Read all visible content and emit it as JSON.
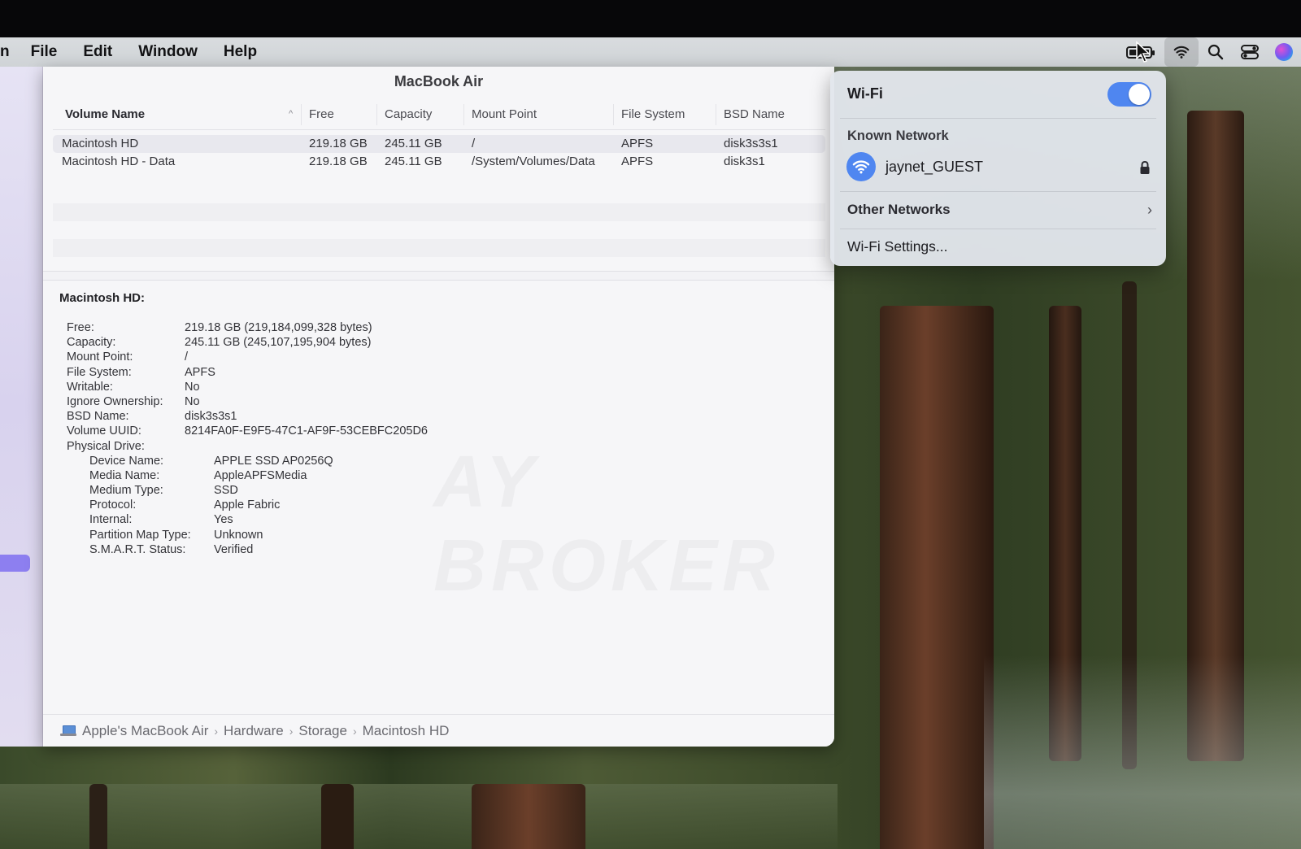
{
  "menubar": {
    "app_fragment": "n",
    "items": [
      "File",
      "Edit",
      "Window",
      "Help"
    ]
  },
  "window": {
    "title": "MacBook Air",
    "table": {
      "headers": [
        "Volume Name",
        "Free",
        "Capacity",
        "Mount Point",
        "File System",
        "BSD Name"
      ],
      "rows": [
        [
          "Macintosh HD",
          "219.18 GB",
          "245.11 GB",
          "/",
          "APFS",
          "disk3s3s1"
        ],
        [
          "Macintosh HD - Data",
          "219.18 GB",
          "245.11 GB",
          "/System/Volumes/Data",
          "APFS",
          "disk3s1"
        ]
      ]
    },
    "detail": {
      "title": "Macintosh HD:",
      "fields": [
        {
          "key": "Free:",
          "value": "219.18 GB (219,184,099,328 bytes)"
        },
        {
          "key": "Capacity:",
          "value": "245.11 GB (245,107,195,904 bytes)"
        },
        {
          "key": "Mount Point:",
          "value": "/"
        },
        {
          "key": "File System:",
          "value": "APFS"
        },
        {
          "key": "Writable:",
          "value": "No"
        },
        {
          "key": "Ignore Ownership:",
          "value": "No"
        },
        {
          "key": "BSD Name:",
          "value": "disk3s3s1"
        },
        {
          "key": "Volume UUID:",
          "value": "8214FA0F-E9F5-47C1-AF9F-53CEBFC205D6"
        },
        {
          "key": "Physical Drive:",
          "value": ""
        }
      ],
      "physical_drive": [
        {
          "key": "Device Name:",
          "value": "APPLE SSD AP0256Q"
        },
        {
          "key": "Media Name:",
          "value": "AppleAPFSMedia"
        },
        {
          "key": "Medium Type:",
          "value": "SSD"
        },
        {
          "key": "Protocol:",
          "value": "Apple Fabric"
        },
        {
          "key": "Internal:",
          "value": "Yes"
        },
        {
          "key": "Partition Map Type:",
          "value": "Unknown"
        },
        {
          "key": "S.M.A.R.T. Status:",
          "value": "Verified"
        }
      ]
    },
    "pathbar": [
      "Apple's MacBook Air",
      "Hardware",
      "Storage",
      "Macintosh HD"
    ]
  },
  "wifi_menu": {
    "title": "Wi-Fi",
    "enabled": true,
    "known_network_label": "Known Network",
    "network_name": "jaynet_GUEST",
    "other_networks_label": "Other Networks",
    "settings_label": "Wi-Fi Settings..."
  },
  "icons": {
    "menubar_right": [
      "battery-icon",
      "wifi-icon",
      "search-icon",
      "control-center-icon",
      "siri-icon"
    ]
  },
  "colors": {
    "accent": "#4f86f0",
    "sidebar_selection": "#8d7ff0"
  }
}
